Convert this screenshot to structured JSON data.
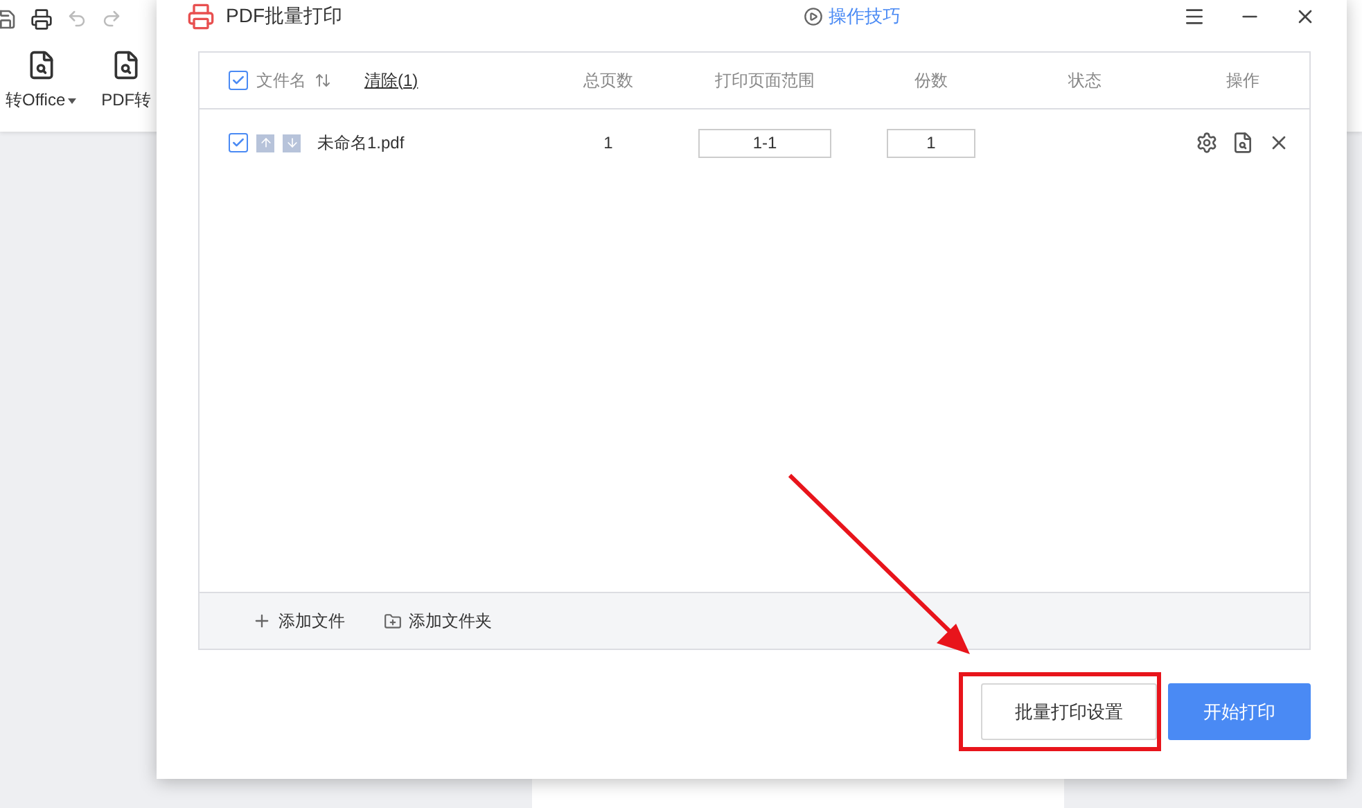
{
  "background_app": {
    "toolbar_buttons": [
      {
        "label": "转Office",
        "dropdown": true
      },
      {
        "label": "PDF转",
        "dropdown": false
      }
    ]
  },
  "dialog": {
    "title": "PDF批量打印",
    "tips_link": "操作技巧",
    "table": {
      "select_all_checked": true,
      "name_column": "文件名",
      "clear_link": "清除(1)",
      "columns": [
        "总页数",
        "打印页面范围",
        "份数",
        "状态",
        "操作"
      ],
      "rows": [
        {
          "checked": true,
          "name": "未命名1.pdf",
          "pages": "1",
          "range": "1-1",
          "copies": "1"
        }
      ]
    },
    "footer_actions": [
      {
        "kind": "file",
        "label": "添加文件"
      },
      {
        "kind": "folder",
        "label": "添加文件夹"
      }
    ],
    "buttons": [
      {
        "kind": "secondary",
        "label": "批量打印设置",
        "highlighted": true
      },
      {
        "kind": "primary",
        "label": "开始打印",
        "highlighted": false
      }
    ]
  }
}
